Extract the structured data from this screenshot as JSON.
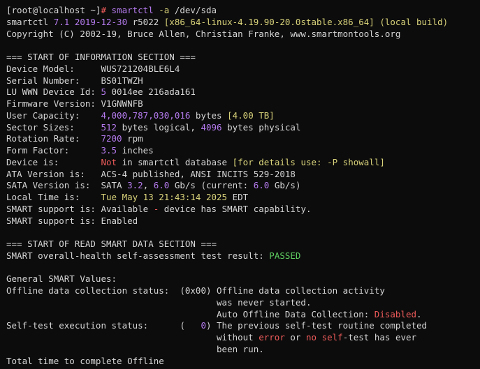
{
  "lines": [
    [
      {
        "t": "[root@localhost ~]",
        "c": "default"
      },
      {
        "t": "# ",
        "c": "red"
      },
      {
        "t": "smartctl ",
        "c": "num"
      },
      {
        "t": "-a ",
        "c": "str"
      },
      {
        "t": "/dev/sda",
        "c": "default"
      }
    ],
    [
      {
        "t": "smartctl ",
        "c": "default"
      },
      {
        "t": "7.1 2019-12-30",
        "c": "num"
      },
      {
        "t": " r5022 ",
        "c": "default"
      },
      {
        "t": "[x86_64-linux-4.19.90-20.0stable.x86_64]",
        "c": "str"
      },
      {
        "t": " (local build)",
        "c": "str"
      }
    ],
    [
      {
        "t": "Copyright (C) 2002-19, Bruce Allen, Christian Franke, www.smartmontools.org",
        "c": "default"
      }
    ],
    [
      {
        "t": "",
        "c": "default"
      }
    ],
    [
      {
        "t": "=== START OF INFORMATION SECTION ===",
        "c": "default"
      }
    ],
    [
      {
        "t": "Device Model:     ",
        "c": "default"
      },
      {
        "t": "WUS721204BLE6L4",
        "c": "default"
      }
    ],
    [
      {
        "t": "Serial Number:    ",
        "c": "default"
      },
      {
        "t": "BS01TWZH",
        "c": "default"
      }
    ],
    [
      {
        "t": "LU WWN Device Id: ",
        "c": "default"
      },
      {
        "t": "5",
        "c": "num"
      },
      {
        "t": " 0014ee 216ada161",
        "c": "default"
      }
    ],
    [
      {
        "t": "Firmware Version: ",
        "c": "default"
      },
      {
        "t": "V1GNWNFB",
        "c": "default"
      }
    ],
    [
      {
        "t": "User Capacity:    ",
        "c": "default"
      },
      {
        "t": "4,000,787,030,016",
        "c": "num"
      },
      {
        "t": " bytes ",
        "c": "default"
      },
      {
        "t": "[4.00 TB]",
        "c": "str"
      }
    ],
    [
      {
        "t": "Sector Sizes:     ",
        "c": "default"
      },
      {
        "t": "512",
        "c": "num"
      },
      {
        "t": " bytes logical, ",
        "c": "default"
      },
      {
        "t": "4096",
        "c": "num"
      },
      {
        "t": " bytes physical",
        "c": "default"
      }
    ],
    [
      {
        "t": "Rotation Rate:    ",
        "c": "default"
      },
      {
        "t": "7200",
        "c": "num"
      },
      {
        "t": " rpm",
        "c": "default"
      }
    ],
    [
      {
        "t": "Form Factor:      ",
        "c": "default"
      },
      {
        "t": "3.5",
        "c": "num"
      },
      {
        "t": " inches",
        "c": "default"
      }
    ],
    [
      {
        "t": "Device is:        ",
        "c": "default"
      },
      {
        "t": "Not",
        "c": "red"
      },
      {
        "t": " in smartctl database ",
        "c": "default"
      },
      {
        "t": "[for details use: ",
        "c": "str"
      },
      {
        "t": "-P",
        "c": "str"
      },
      {
        "t": " showall]",
        "c": "str"
      }
    ],
    [
      {
        "t": "ATA Version is:   ",
        "c": "default"
      },
      {
        "t": "ACS-4 published, ANSI INCITS 529-2018",
        "c": "default"
      }
    ],
    [
      {
        "t": "SATA Version is:  ",
        "c": "default"
      },
      {
        "t": "SATA ",
        "c": "default"
      },
      {
        "t": "3.2",
        "c": "num"
      },
      {
        "t": ", ",
        "c": "default"
      },
      {
        "t": "6.0",
        "c": "num"
      },
      {
        "t": " Gb/s (current: ",
        "c": "default"
      },
      {
        "t": "6.0",
        "c": "num"
      },
      {
        "t": " Gb/s)",
        "c": "default"
      }
    ],
    [
      {
        "t": "Local Time is:    ",
        "c": "default"
      },
      {
        "t": "Tue May 13 21:43:14 2025",
        "c": "str"
      },
      {
        "t": " EDT",
        "c": "default"
      }
    ],
    [
      {
        "t": "SMART support is: ",
        "c": "default"
      },
      {
        "t": "Available ",
        "c": "default"
      },
      {
        "t": "-",
        "c": "red"
      },
      {
        "t": " device has SMART capability.",
        "c": "default"
      }
    ],
    [
      {
        "t": "SMART support is: ",
        "c": "default"
      },
      {
        "t": "Enabled",
        "c": "default"
      }
    ],
    [
      {
        "t": "",
        "c": "default"
      }
    ],
    [
      {
        "t": "=== START OF READ SMART DATA SECTION ===",
        "c": "default"
      }
    ],
    [
      {
        "t": "SMART overall-health self-assessment test result: ",
        "c": "default"
      },
      {
        "t": "PASSED",
        "c": "ok"
      }
    ],
    [
      {
        "t": "",
        "c": "default"
      }
    ],
    [
      {
        "t": "General SMART Values:",
        "c": "default"
      }
    ],
    [
      {
        "t": "Offline data collection status:  (",
        "c": "default"
      },
      {
        "t": "0x00",
        "c": "default"
      },
      {
        "t": ") Offline data collection activity",
        "c": "default"
      }
    ],
    [
      {
        "t": "                                        was never started.",
        "c": "default"
      }
    ],
    [
      {
        "t": "                                        Auto Offline Data Collection: ",
        "c": "default"
      },
      {
        "t": "Disabled",
        "c": "red"
      },
      {
        "t": ".",
        "c": "default"
      }
    ],
    [
      {
        "t": "Self-test execution status:      (   ",
        "c": "default"
      },
      {
        "t": "0",
        "c": "num"
      },
      {
        "t": ") The previous self-test routine completed",
        "c": "default"
      }
    ],
    [
      {
        "t": "                                        without ",
        "c": "default"
      },
      {
        "t": "error",
        "c": "red"
      },
      {
        "t": " or ",
        "c": "default"
      },
      {
        "t": "no",
        "c": "red"
      },
      {
        "t": " ",
        "c": "default"
      },
      {
        "t": "self",
        "c": "red"
      },
      {
        "t": "-test has ever",
        "c": "default"
      }
    ],
    [
      {
        "t": "                                        been run.",
        "c": "default"
      }
    ],
    [
      {
        "t": "Total time to complete Offline",
        "c": "default"
      }
    ]
  ]
}
